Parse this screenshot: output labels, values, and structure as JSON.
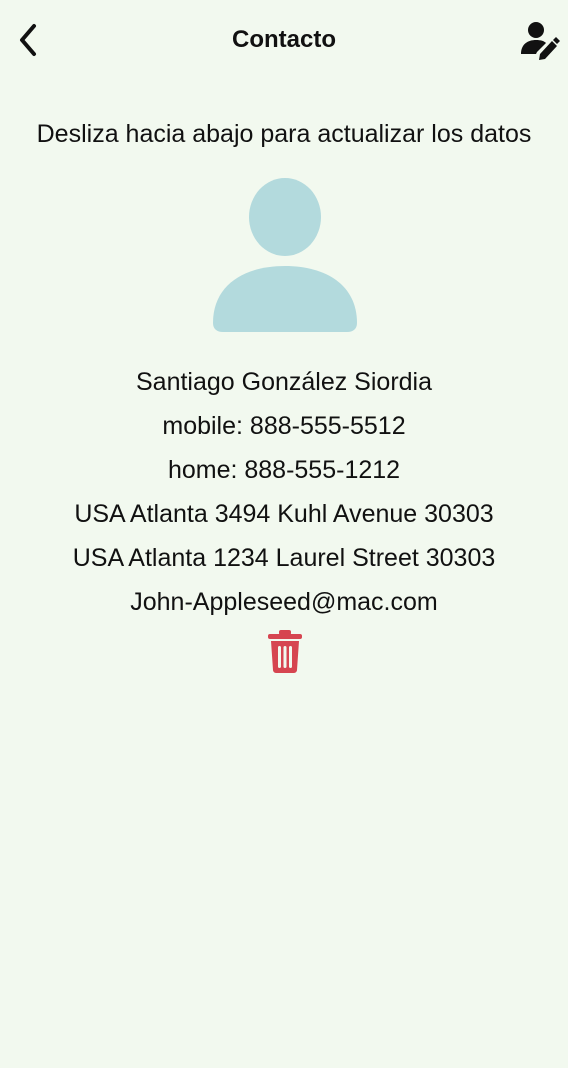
{
  "nav": {
    "title": "Contacto",
    "back_icon": "chevron-left-icon",
    "edit_icon": "edit-contact-icon"
  },
  "hint": "Desliza hacia abajo para actualizar los datos",
  "avatar": {
    "icon": "person-placeholder-icon",
    "color": "#b3dadd"
  },
  "contact": {
    "name": "Santiago González Siordia",
    "phones": [
      "mobile: 888-555-5512",
      "home: 888-555-1212"
    ],
    "addresses": [
      "USA Atlanta 3494 Kuhl Avenue 30303",
      "USA Atlanta 1234 Laurel Street 30303"
    ],
    "email": "John-Appleseed@mac.com"
  },
  "actions": {
    "delete_icon": "trash-icon",
    "delete_color": "#d64550"
  },
  "colors": {
    "background": "#f2f9ef",
    "text": "#111111"
  }
}
